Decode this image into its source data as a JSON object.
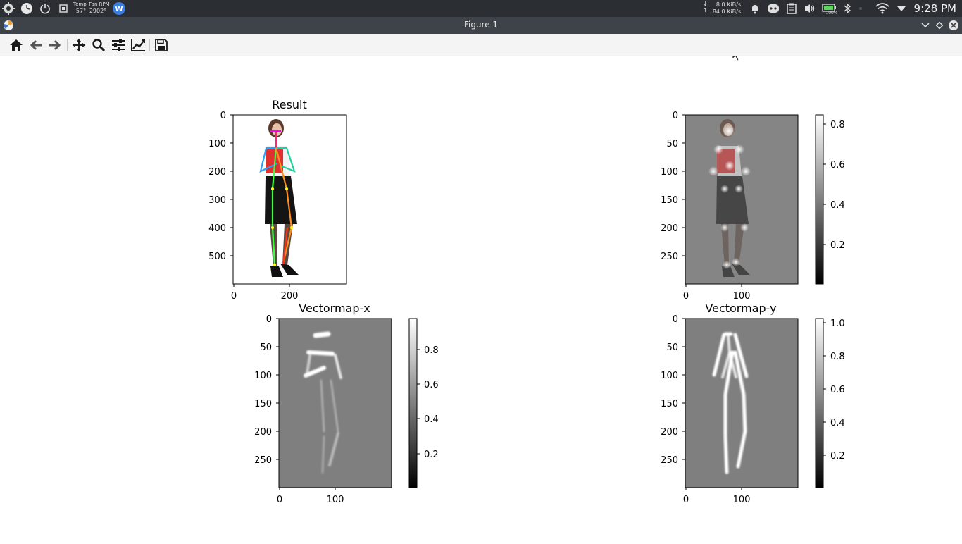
{
  "taskbar": {
    "temp_label": "Temp",
    "temp_value": "57°",
    "fan_label": "Fan RPM",
    "fan_value": "2902°",
    "net_down": "8.0 KiB/s",
    "net_up": "84.0 KiB/s",
    "battery": "100%",
    "clock": "9:28 PM"
  },
  "window": {
    "title": "Figure 1"
  },
  "toolbar": {
    "buttons": [
      "home-icon",
      "back-arrow-icon",
      "forward-arrow-icon",
      "pan-icon",
      "zoom-icon",
      "configure-subplots-icon",
      "edit-axis-icon",
      "save-icon"
    ]
  },
  "figure": {
    "subplots": [
      {
        "title": "Result",
        "yticks": [
          "0",
          "100",
          "200",
          "300",
          "400",
          "500"
        ],
        "xticks": [
          "0",
          "200"
        ]
      },
      {
        "title": "",
        "yticks": [
          "0",
          "50",
          "100",
          "150",
          "200",
          "250"
        ],
        "xticks": [
          "0",
          "100"
        ],
        "colorbar_ticks": [
          "0.8",
          "0.6",
          "0.4",
          "0.2"
        ]
      },
      {
        "title": "Vectormap-x",
        "yticks": [
          "0",
          "50",
          "100",
          "150",
          "200",
          "250"
        ],
        "xticks": [
          "0",
          "100"
        ],
        "colorbar_ticks": [
          "0.8",
          "0.6",
          "0.4",
          "0.2"
        ]
      },
      {
        "title": "Vectormap-y",
        "yticks": [
          "0",
          "50",
          "100",
          "150",
          "200",
          "250"
        ],
        "xticks": [
          "0",
          "100"
        ],
        "colorbar_ticks": [
          "1.0",
          "0.8",
          "0.6",
          "0.4",
          "0.2"
        ]
      }
    ]
  }
}
